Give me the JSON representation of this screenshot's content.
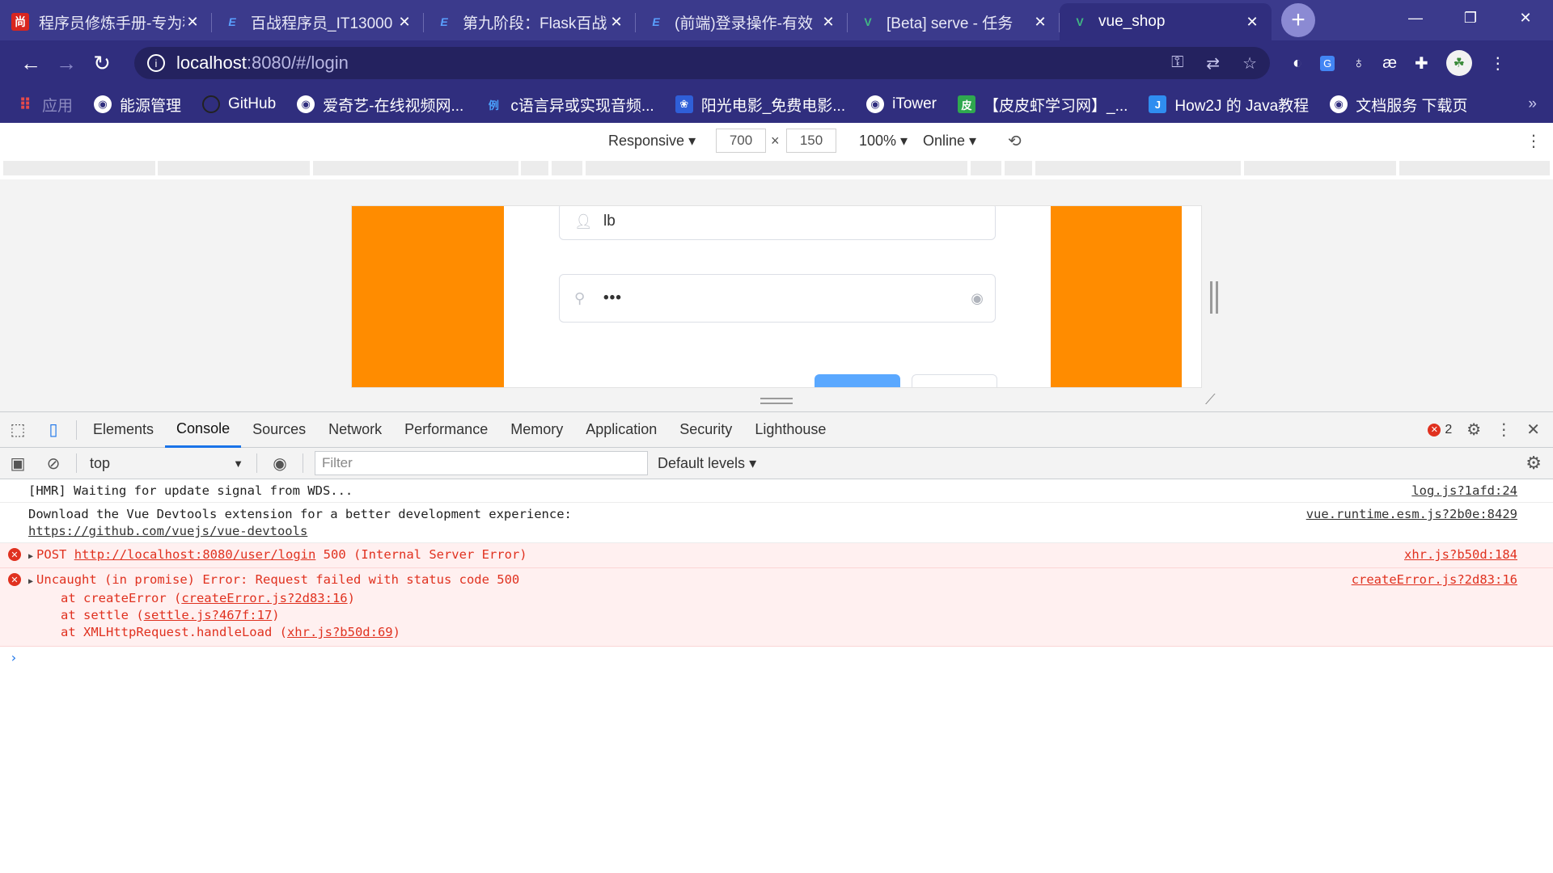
{
  "tabs": [
    {
      "title": "程序员修炼手册-专为程序员打造",
      "favicon": "尚",
      "color": "#d8261f",
      "active": false
    },
    {
      "title": "百战程序员_IT13000",
      "favicon": "E",
      "color": "#1e64d2",
      "active": false
    },
    {
      "title": "第九阶段：Flask百战",
      "favicon": "E",
      "color": "#1e64d2",
      "active": false
    },
    {
      "title": "(前端)登录操作-有效",
      "favicon": "E",
      "color": "#1e64d2",
      "active": false
    },
    {
      "title": "[Beta] serve - 任务",
      "favicon": "V",
      "color": "#41b883",
      "active": false
    },
    {
      "title": "vue_shop",
      "favicon": "V",
      "color": "#41b883",
      "active": true
    }
  ],
  "toolbar": {
    "url_host": "localhost",
    "url_path": ":8080/#/login"
  },
  "bookmarks": [
    {
      "label": "应用",
      "icon": "apps-grid-icon"
    },
    {
      "label": "能源管理",
      "icon": "globe-icon"
    },
    {
      "label": "GitHub",
      "icon": "github-icon"
    },
    {
      "label": "爱奇艺-在线视频网...",
      "icon": "globe-icon"
    },
    {
      "label": "c语言异或实现音频...",
      "icon": "li-icon"
    },
    {
      "label": "阳光电影_免费电影...",
      "icon": "baidu-icon"
    },
    {
      "label": "iTower",
      "icon": "globe-icon"
    },
    {
      "label": "【皮皮虾学习网】_...",
      "icon": "pipixia-icon"
    },
    {
      "label": "How2J 的 Java教程",
      "icon": "j-icon"
    },
    {
      "label": "文档服务 下载页",
      "icon": "globe-icon"
    }
  ],
  "device_toolbar": {
    "mode": "Responsive",
    "width": "700",
    "height": "150",
    "zoom": "100%",
    "network": "Online"
  },
  "page": {
    "username_value": "lb",
    "password_value": "•••"
  },
  "devtools": {
    "tabs": [
      "Elements",
      "Console",
      "Sources",
      "Network",
      "Performance",
      "Memory",
      "Application",
      "Security",
      "Lighthouse"
    ],
    "active_tab": "Console",
    "error_count": "2"
  },
  "console_toolbar": {
    "context": "top",
    "filter_placeholder": "Filter",
    "levels": "Default levels"
  },
  "messages": {
    "m1": {
      "text": "[HMR] Waiting for update signal from WDS...",
      "source": "log.js?1afd:24"
    },
    "m2": {
      "text": "Download the Vue Devtools extension for a better development experience:",
      "link": "https://github.com/vuejs/vue-devtools",
      "source": "vue.runtime.esm.js?2b0e:8429"
    },
    "m3": {
      "method": "POST",
      "url": "http://localhost:8080/user/login",
      "status": "500 (Internal Server Error)",
      "source": "xhr.js?b50d:184"
    },
    "m4": {
      "text": "Uncaught (in promise) Error: Request failed with status code 500",
      "source": "createError.js?2d83:16",
      "stack": [
        {
          "fn": "at createError (",
          "loc": "createError.js?2d83:16",
          "end": ")"
        },
        {
          "fn": "at settle (",
          "loc": "settle.js?467f:17",
          "end": ")"
        },
        {
          "fn": "at XMLHttpRequest.handleLoad (",
          "loc": "xhr.js?b50d:69",
          "end": ")"
        }
      ]
    }
  },
  "colors": {
    "chrome_frame": "#3b3a8c",
    "toolbar": "#302e7e",
    "accent": "#1a73e8",
    "error": "#e0311f",
    "page_orange": "#ff8c00"
  }
}
